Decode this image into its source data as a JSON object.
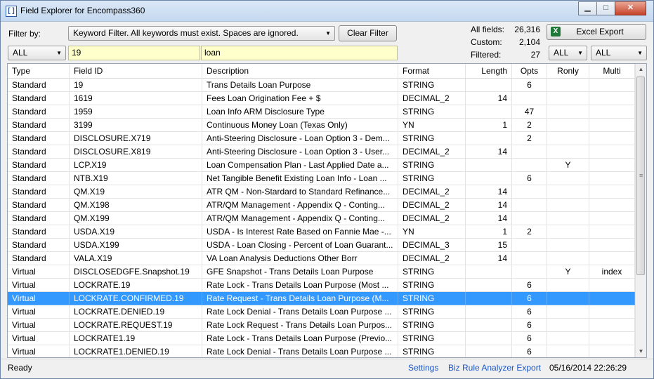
{
  "window": {
    "title": "Field Explorer for Encompass360",
    "app_icon": "bracket-icon"
  },
  "filter": {
    "label": "Filter by:",
    "mode": "Keyword Filter.  All keywords must exist.  Spaces are ignored.",
    "clear_label": "Clear Filter",
    "type_select": "ALL",
    "field_id_value": "19",
    "description_value": "loan",
    "ronly_select": "ALL",
    "multi_select": "ALL"
  },
  "stats": {
    "all_label": "All fields:",
    "all_value": "26,316",
    "custom_label": "Custom:",
    "custom_value": "2,104",
    "filtered_label": "Filtered:",
    "filtered_value": "27"
  },
  "excel_label": "Excel Export",
  "columns": [
    "Type",
    "Field ID",
    "Description",
    "Format",
    "Length",
    "Opts",
    "Ronly",
    "Multi"
  ],
  "rows": [
    [
      "Standard",
      "19",
      "Trans Details Loan Purpose",
      "STRING",
      "",
      "6",
      "",
      ""
    ],
    [
      "Standard",
      "1619",
      "Fees Loan Origination Fee + $",
      "DECIMAL_2",
      "14",
      "",
      "",
      ""
    ],
    [
      "Standard",
      "1959",
      "Loan Info ARM Disclosure Type",
      "STRING",
      "",
      "47",
      "",
      ""
    ],
    [
      "Standard",
      "3199",
      "Continuous Money Loan (Texas Only)",
      "YN",
      "1",
      "2",
      "",
      ""
    ],
    [
      "Standard",
      "DISCLOSURE.X719",
      "Anti-Steering Disclosure - Loan Option 3 - Dem...",
      "STRING",
      "",
      "2",
      "",
      ""
    ],
    [
      "Standard",
      "DISCLOSURE.X819",
      "Anti-Steering Disclosure - Loan Option 3 - User...",
      "DECIMAL_2",
      "14",
      "",
      "",
      ""
    ],
    [
      "Standard",
      "LCP.X19",
      "Loan Compensation Plan - Last Applied Date a...",
      "STRING",
      "",
      "",
      "Y",
      ""
    ],
    [
      "Standard",
      "NTB.X19",
      "Net Tangible Benefit Existing Loan Info - Loan ...",
      "STRING",
      "",
      "6",
      "",
      ""
    ],
    [
      "Standard",
      "QM.X19",
      "ATR QM - Non-Stardard to Standard Refinance...",
      "DECIMAL_2",
      "14",
      "",
      "",
      ""
    ],
    [
      "Standard",
      "QM.X198",
      "ATR/QM Management - Appendix Q - Conting...",
      "DECIMAL_2",
      "14",
      "",
      "",
      ""
    ],
    [
      "Standard",
      "QM.X199",
      "ATR/QM Management - Appendix Q - Conting...",
      "DECIMAL_2",
      "14",
      "",
      "",
      ""
    ],
    [
      "Standard",
      "USDA.X19",
      "USDA - Is Interest Rate Based on Fannie Mae -...",
      "YN",
      "1",
      "2",
      "",
      ""
    ],
    [
      "Standard",
      "USDA.X199",
      "USDA - Loan Closing - Percent of Loan Guarant...",
      "DECIMAL_3",
      "15",
      "",
      "",
      ""
    ],
    [
      "Standard",
      "VALA.X19",
      "VA Loan Analysis Deductions Other Borr",
      "DECIMAL_2",
      "14",
      "",
      "",
      ""
    ],
    [
      "Virtual",
      "DISCLOSEDGFE.Snapshot.19",
      "GFE Snapshot - Trans Details Loan Purpose",
      "STRING",
      "",
      "",
      "Y",
      "index"
    ],
    [
      "Virtual",
      "LOCKRATE.19",
      "Rate Lock - Trans Details Loan Purpose (Most ...",
      "STRING",
      "",
      "6",
      "",
      ""
    ],
    [
      "Virtual",
      "LOCKRATE.CONFIRMED.19",
      "Rate Request - Trans Details Loan Purpose (M...",
      "STRING",
      "",
      "6",
      "",
      ""
    ],
    [
      "Virtual",
      "LOCKRATE.DENIED.19",
      "Rate Lock Denial - Trans Details Loan Purpose ...",
      "STRING",
      "",
      "6",
      "",
      ""
    ],
    [
      "Virtual",
      "LOCKRATE.REQUEST.19",
      "Rate Lock Request - Trans Details Loan Purpos...",
      "STRING",
      "",
      "6",
      "",
      ""
    ],
    [
      "Virtual",
      "LOCKRATE1.19",
      "Rate Lock - Trans Details Loan Purpose (Previo...",
      "STRING",
      "",
      "6",
      "",
      ""
    ],
    [
      "Virtual",
      "LOCKRATE1.DENIED.19",
      "Rate Lock Denial - Trans Details Loan Purpose ...",
      "STRING",
      "",
      "6",
      "",
      ""
    ]
  ],
  "selected_row": 16,
  "status": {
    "text": "Ready",
    "settings_link": "Settings",
    "export_link": "Biz Rule Analyzer Export",
    "datetime": "05/16/2014 22:26:29"
  },
  "colors": {
    "selection": "#3399ff",
    "input_bg": "#ffffcc",
    "link": "#1c55c4"
  }
}
